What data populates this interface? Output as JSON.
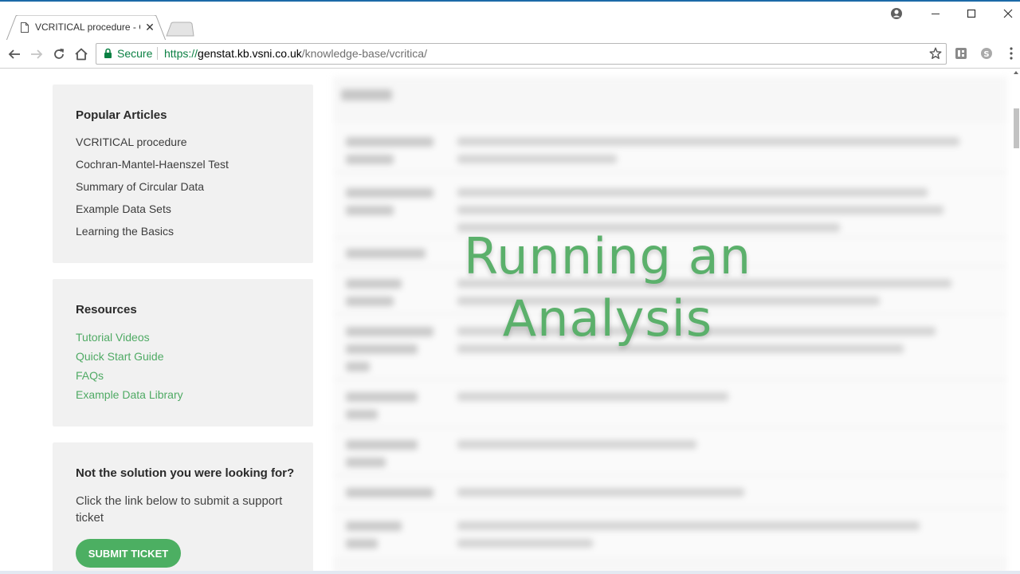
{
  "browser": {
    "tab_title": "VCRITICAL procedure - G",
    "tab_close": "✕",
    "secure_label": "Secure",
    "url_protocol": "https://",
    "url_host": "genstat.kb.vsni.co.uk",
    "url_path": "/knowledge-base/vcritica/",
    "window_controls": {
      "minimize": "—",
      "maximize": "☐",
      "close": "✕"
    },
    "accent_color": "#0b8043"
  },
  "sidebar": {
    "popular": {
      "heading": "Popular Articles",
      "items": [
        {
          "label": "VCRITICAL procedure"
        },
        {
          "label": "Cochran-Mantel-Haenszel Test"
        },
        {
          "label": "Summary of Circular Data"
        },
        {
          "label": "Example Data Sets"
        },
        {
          "label": "Learning the Basics"
        }
      ]
    },
    "resources": {
      "heading": "Resources",
      "items": [
        {
          "label": "Tutorial Videos"
        },
        {
          "label": "Quick Start Guide"
        },
        {
          "label": "FAQs"
        },
        {
          "label": "Example Data Library"
        }
      ]
    },
    "support": {
      "heading": "Not the solution you were looking for?",
      "text": "Click the link below to submit a support ticket",
      "button_label": "SUBMIT TICKET"
    }
  },
  "overlay": {
    "title_line1": "Running an",
    "title_line2": "Analysis",
    "color": "#5bb06b"
  },
  "colors": {
    "link_green": "#4faa64",
    "button_green": "#4caf62",
    "card_bg": "#f1f1f1"
  }
}
